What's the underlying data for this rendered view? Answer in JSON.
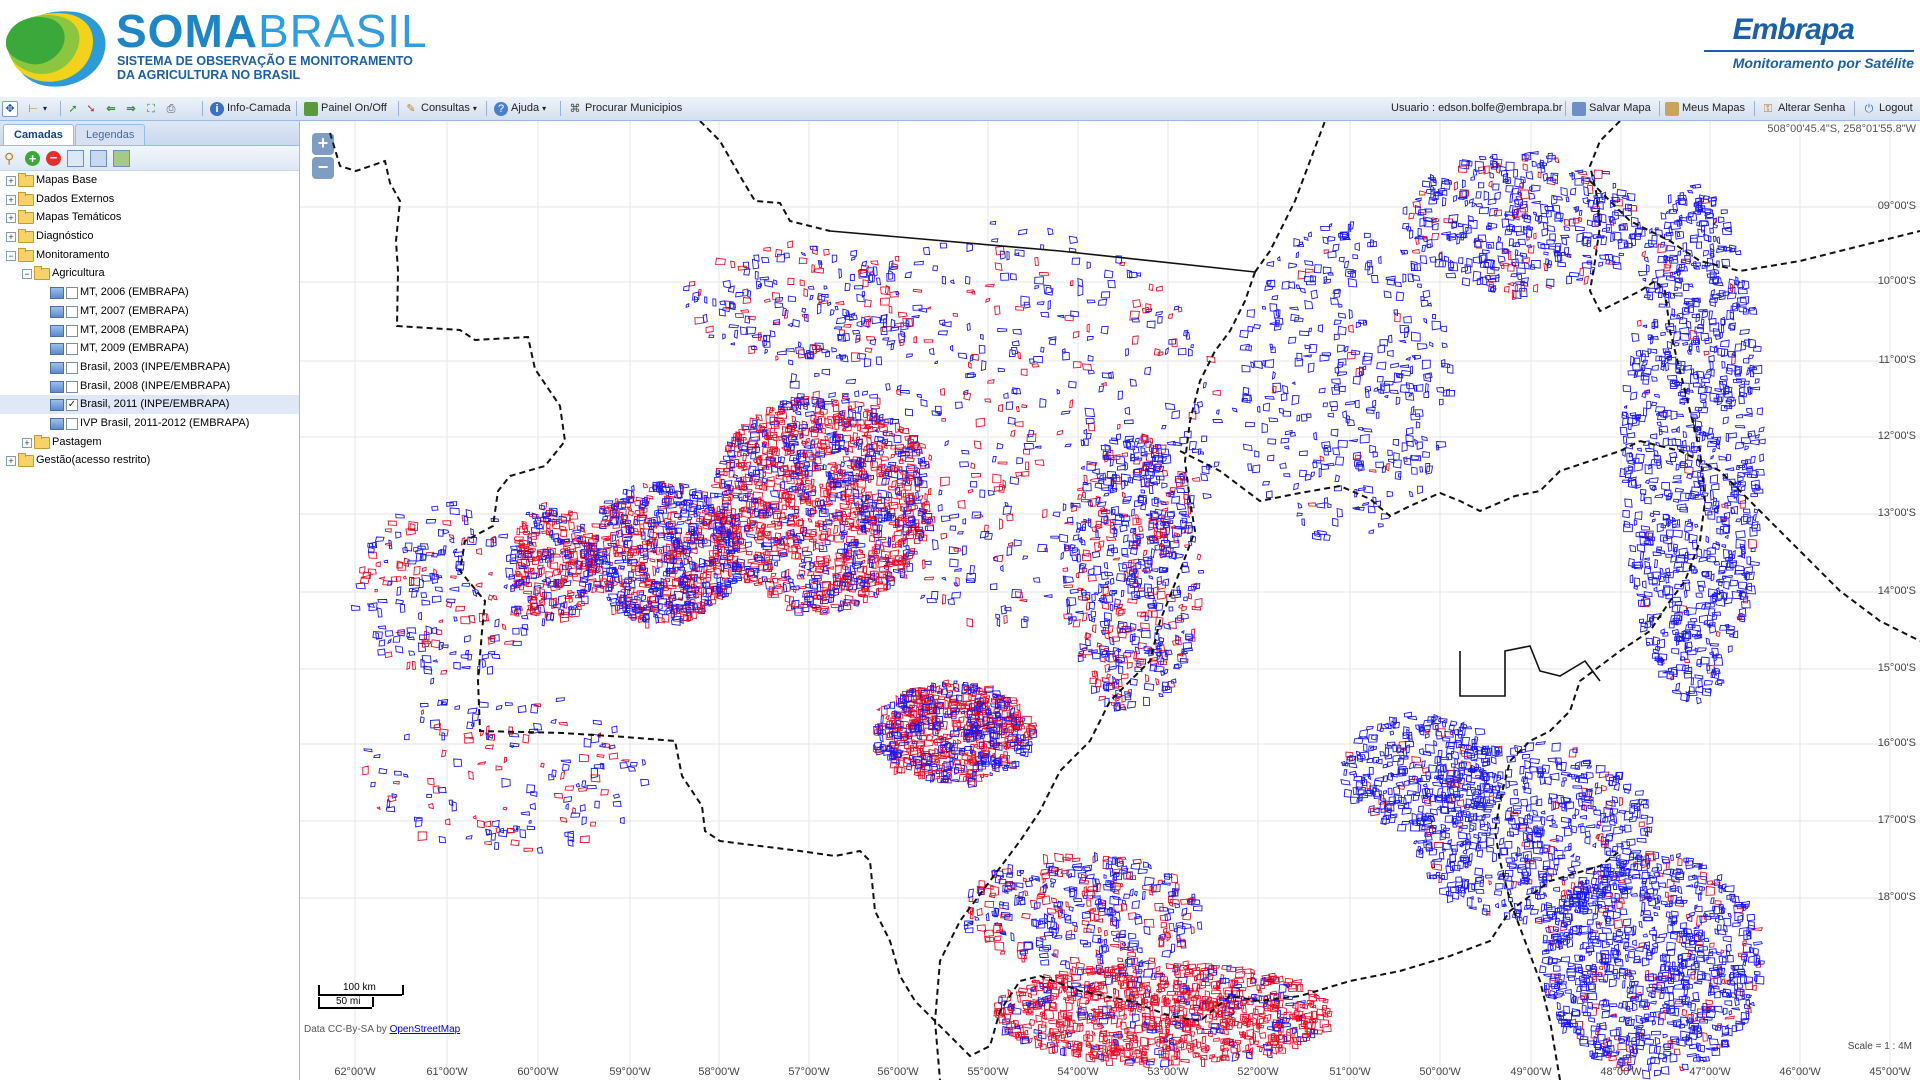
{
  "header": {
    "brand_bold": "SOMA",
    "brand_light": "BRASIL",
    "brand_line1": "SISTEMA DE OBSERVAÇÃO E MONITORAMENTO",
    "brand_line2": "DA AGRICULTURA NO BRASIL",
    "embrapa_name": "Embrapa",
    "embrapa_tagline": "Monitoramento por Satélite"
  },
  "toolbar": {
    "info_camada": "Info-Camada",
    "painel": "Painel On/Off",
    "consultas": "Consultas",
    "ajuda": "Ajuda",
    "procurar": "Procurar Municipios",
    "usuario": "Usuario : edson.bolfe@embrapa.br",
    "salvar": "Salvar Mapa",
    "meus_mapas": "Meus Mapas",
    "alterar_senha": "Alterar Senha",
    "logout": "Logout"
  },
  "panel": {
    "tabs": [
      "Camadas",
      "Legendas"
    ],
    "tree": [
      {
        "label": "Mapas Base"
      },
      {
        "label": "Dados Externos"
      },
      {
        "label": "Mapas Temáticos"
      },
      {
        "label": "Diagnóstico"
      },
      {
        "label": "Monitoramento"
      },
      {
        "label": "Agricultura"
      },
      {
        "label": "MT, 2006 (EMBRAPA)",
        "checked": false
      },
      {
        "label": "MT, 2007 (EMBRAPA)",
        "checked": false
      },
      {
        "label": "MT, 2008 (EMBRAPA)",
        "checked": false
      },
      {
        "label": "MT, 2009 (EMBRAPA)",
        "checked": false
      },
      {
        "label": "Brasil, 2003 (INPE/EMBRAPA)",
        "checked": false
      },
      {
        "label": "Brasil, 2008 (INPE/EMBRAPA)",
        "checked": false
      },
      {
        "label": "Brasil, 2011 (INPE/EMBRAPA)",
        "checked": true
      },
      {
        "label": "IVP Brasil, 2011-2012 (EMBRAPA)",
        "checked": false
      },
      {
        "label": "Pastagem"
      },
      {
        "label": "Gestão(acesso restrito)"
      }
    ]
  },
  "map": {
    "coord_readout": "508°00'45.4\"S, 258°01'55.8\"W",
    "lat_labels": [
      "09°00'S",
      "10°00'S",
      "11°00'S",
      "12°00'S",
      "13°00'S",
      "14°00'S",
      "15°00'S",
      "16°00'S",
      "17°00'S",
      "18°00'S"
    ],
    "lon_labels": [
      "62°00'W",
      "61°00'W",
      "60°00'W",
      "59°00'W",
      "58°00'W",
      "57°00'W",
      "56°00'W",
      "55°00'W",
      "54°00'W",
      "53°00'W",
      "52°00'W",
      "51°00'W",
      "50°00'W",
      "49°00'W",
      "48°00'W",
      "47°00'W",
      "46°00'W",
      "45°00'W"
    ],
    "scale_km": "100 km",
    "scale_mi": "50 mi",
    "attribution_prefix": "Data CC-By-SA by ",
    "attribution_link": "OpenStreetMap",
    "scale_text": "Scale = 1 : 4M",
    "colors": {
      "red": "#e8102a",
      "blue": "#1a1aef"
    }
  }
}
